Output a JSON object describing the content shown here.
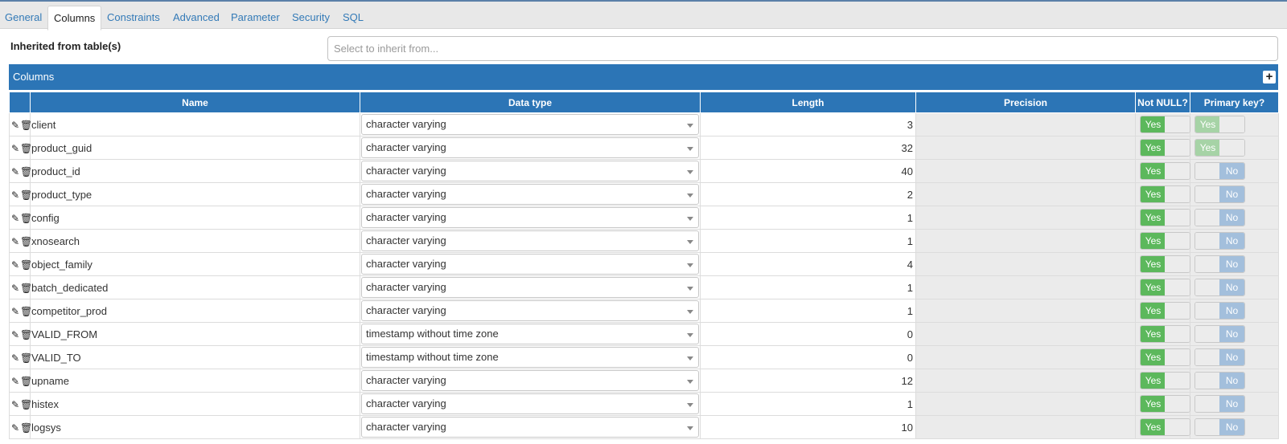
{
  "tabs": [
    "General",
    "Columns",
    "Constraints",
    "Advanced",
    "Parameter",
    "Security",
    "SQL"
  ],
  "inherit": {
    "label": "Inherited from table(s)",
    "placeholder": "Select to inherit from..."
  },
  "panel": {
    "title": "Columns",
    "add_label": "+"
  },
  "headers": {
    "name": "Name",
    "data_type": "Data type",
    "length": "Length",
    "precision": "Precision",
    "not_null": "Not NULL?",
    "primary_key": "Primary key?"
  },
  "toggle_labels": {
    "yes": "Yes",
    "no": "No"
  },
  "rows": [
    {
      "name": "client",
      "data_type": "character varying",
      "length": "3",
      "not_null": "Yes",
      "primary_key": "Yes"
    },
    {
      "name": "product_guid",
      "data_type": "character varying",
      "length": "32",
      "not_null": "Yes",
      "primary_key": "Yes"
    },
    {
      "name": "product_id",
      "data_type": "character varying",
      "length": "40",
      "not_null": "Yes",
      "primary_key": "No"
    },
    {
      "name": "product_type",
      "data_type": "character varying",
      "length": "2",
      "not_null": "Yes",
      "primary_key": "No"
    },
    {
      "name": "config",
      "data_type": "character varying",
      "length": "1",
      "not_null": "Yes",
      "primary_key": "No"
    },
    {
      "name": "xnosearch",
      "data_type": "character varying",
      "length": "1",
      "not_null": "Yes",
      "primary_key": "No"
    },
    {
      "name": "object_family",
      "data_type": "character varying",
      "length": "4",
      "not_null": "Yes",
      "primary_key": "No"
    },
    {
      "name": "batch_dedicated",
      "data_type": "character varying",
      "length": "1",
      "not_null": "Yes",
      "primary_key": "No"
    },
    {
      "name": "competitor_prod",
      "data_type": "character varying",
      "length": "1",
      "not_null": "Yes",
      "primary_key": "No"
    },
    {
      "name": "VALID_FROM",
      "data_type": "timestamp without time zone",
      "length": "0",
      "not_null": "Yes",
      "primary_key": "No"
    },
    {
      "name": "VALID_TO",
      "data_type": "timestamp without time zone",
      "length": "0",
      "not_null": "Yes",
      "primary_key": "No"
    },
    {
      "name": "upname",
      "data_type": "character varying",
      "length": "12",
      "not_null": "Yes",
      "primary_key": "No"
    },
    {
      "name": "histex",
      "data_type": "character varying",
      "length": "1",
      "not_null": "Yes",
      "primary_key": "No"
    },
    {
      "name": "logsys",
      "data_type": "character varying",
      "length": "10",
      "not_null": "Yes",
      "primary_key": "No"
    }
  ],
  "colors": {
    "accent": "#2c75b6",
    "toggle_on": "#5cb85c",
    "toggle_on_disabled": "#a6d3a6",
    "toggle_off_disabled": "#a3bfdc"
  }
}
